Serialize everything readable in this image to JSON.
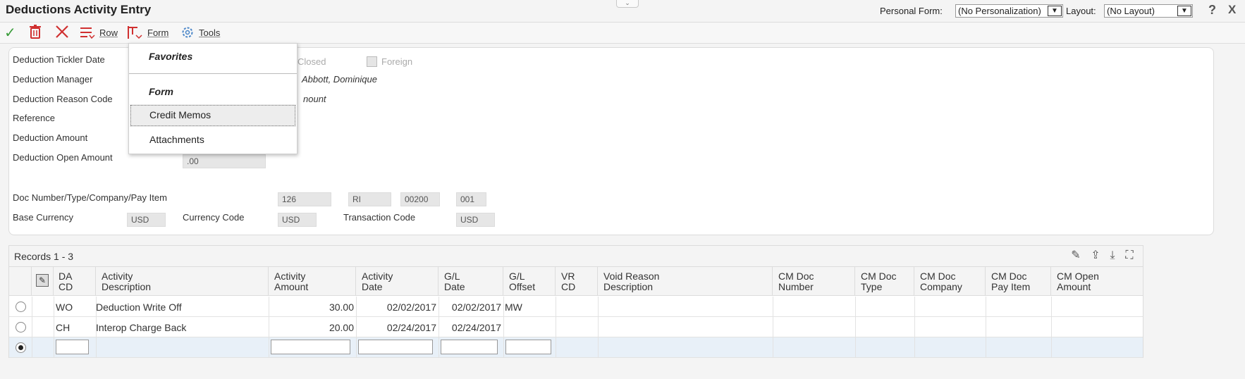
{
  "header": {
    "title": "Deductions Activity Entry",
    "personal_form_label": "Personal Form:",
    "personal_form_value": "(No Personalization)",
    "layout_label": "Layout:",
    "layout_value": "(No Layout)",
    "help_glyph": "?",
    "close_glyph": "X",
    "collapse_glyph": "⌄"
  },
  "toolbar": {
    "ok_icon": "check-icon",
    "delete_icon": "trash-icon",
    "cancel_icon": "close-icon",
    "row_label": "Row",
    "form_label": "Form",
    "tools_label": "Tools"
  },
  "form_menu": {
    "favorites_heading": "Favorites",
    "form_heading": "Form",
    "items": [
      "Credit Memos",
      "Attachments"
    ],
    "active_item": "Credit Memos"
  },
  "form": {
    "tickler_date_label": "Deduction Tickler Date",
    "closed_label": "Closed",
    "foreign_label": "Foreign",
    "manager_label": "Deduction Manager",
    "manager_name": "Abbott, Dominique",
    "reason_code_label": "Deduction Reason Code",
    "reason_code_desc_fragment": "nount",
    "reference_label": "Reference",
    "amount_label": "Deduction Amount",
    "open_amount_label": "Deduction Open Amount",
    "open_amount_value": ".00",
    "doc_label": "Doc Number/Type/Company/Pay Item",
    "doc_number": "126",
    "doc_type": "RI",
    "doc_company": "00200",
    "doc_pay_item": "001",
    "base_currency_label": "Base Currency",
    "base_currency_value": "USD",
    "currency_code_label": "Currency Code",
    "currency_code_value": "USD",
    "transaction_code_label": "Transaction Code",
    "transaction_code_value": "USD"
  },
  "grid": {
    "records_label": "Records 1 - 3",
    "headers": {
      "da_cd": "DA\nCD",
      "activity_desc": "Activity\nDescription",
      "activity_amount": "Activity\nAmount",
      "activity_date": "Activity\nDate",
      "gl_date": "G/L\nDate",
      "gl_offset": "G/L\nOffset",
      "vr_cd": "VR\nCD",
      "void_reason": "Void Reason\nDescription",
      "cm_doc_number": "CM Doc\nNumber",
      "cm_doc_type": "CM Doc\nType",
      "cm_doc_company": "CM Doc\nCompany",
      "cm_doc_pay_item": "CM Doc\nPay Item",
      "cm_open_amount": "CM Open\nAmount"
    },
    "rows": [
      {
        "da_cd": "WO",
        "activity_desc": "Deduction Write Off",
        "activity_amount": "30.00",
        "activity_date": "02/02/2017",
        "gl_date": "02/02/2017",
        "gl_offset": "MW"
      },
      {
        "da_cd": "CH",
        "activity_desc": "Interop Charge Back",
        "activity_amount": "20.00",
        "activity_date": "02/24/2017",
        "gl_date": "02/24/2017",
        "gl_offset": ""
      }
    ]
  }
}
